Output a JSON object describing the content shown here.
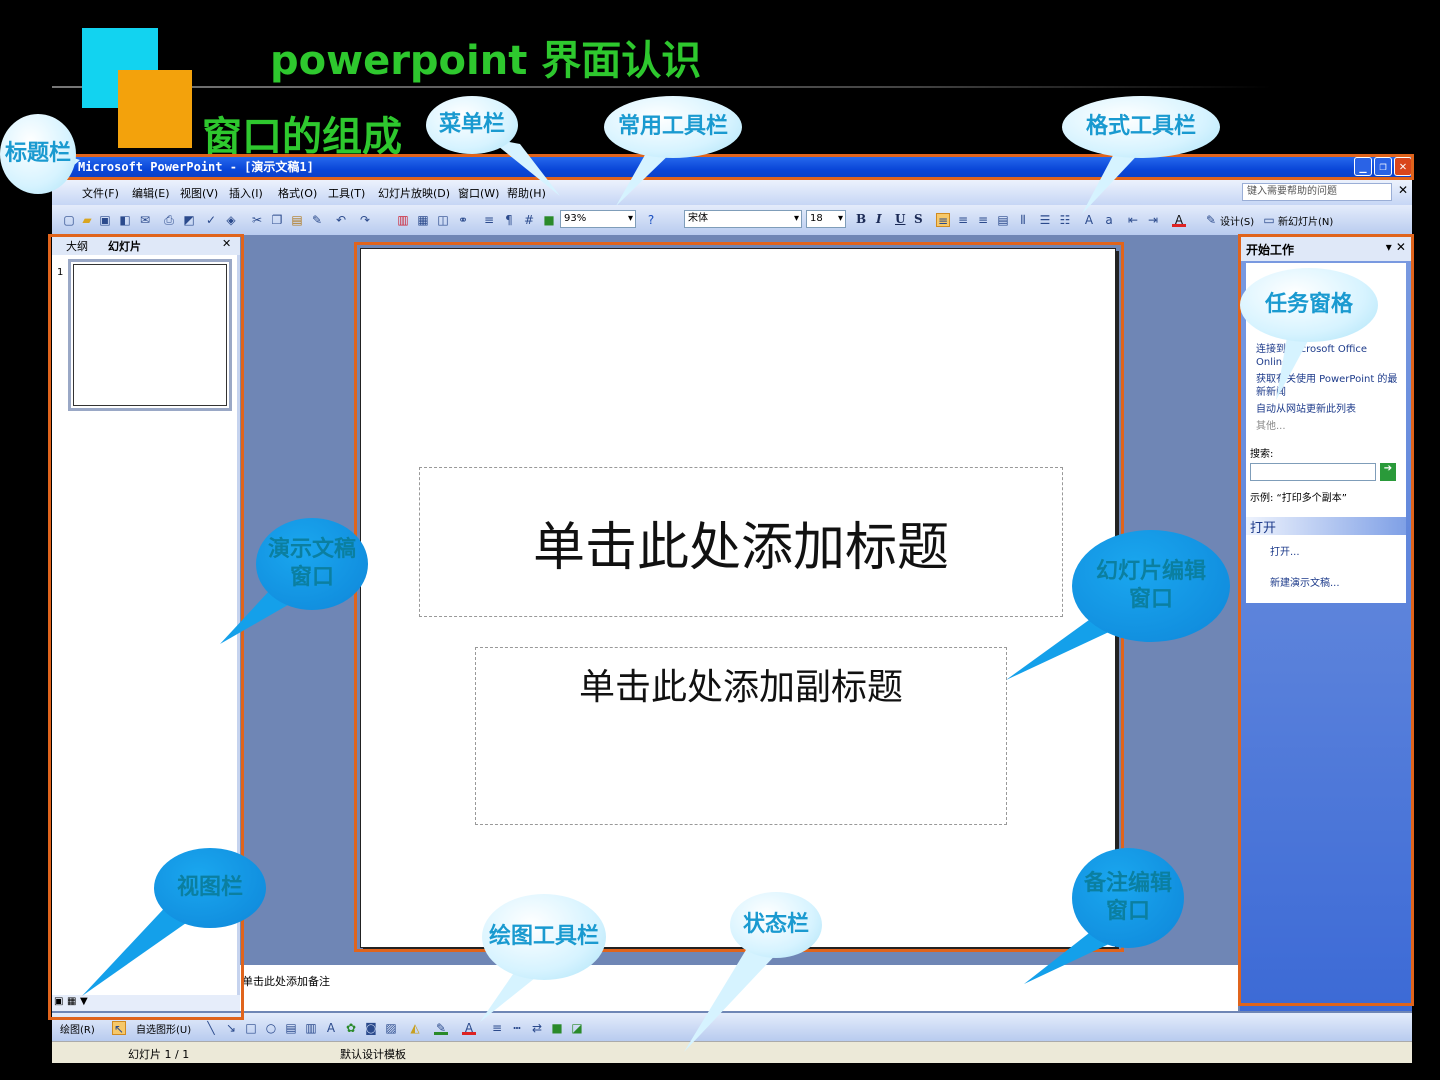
{
  "slide": {
    "title": "powerpoint 界面认识",
    "subtitle": "窗口的组成"
  },
  "window": {
    "title": "Microsoft PowerPoint - [演示文稿1]",
    "menu": [
      "文件(F)",
      "编辑(E)",
      "视图(V)",
      "插入(I)",
      "格式(O)",
      "工具(T)",
      "幻灯片放映(D)",
      "窗口(W)",
      "帮助(H)"
    ],
    "help_placeholder": "键入需要帮助的问题",
    "zoom": "93%",
    "font": "宋体",
    "font_size": "18",
    "format_buttons": [
      "B",
      "I",
      "U",
      "S"
    ],
    "design_label": "设计(S)",
    "new_slide_label": "新幻灯片(N)"
  },
  "left_pane": {
    "tabs": [
      "大纲",
      "幻灯片"
    ],
    "slide_number": "1"
  },
  "editor": {
    "title_placeholder": "单击此处添加标题",
    "subtitle_placeholder": "单击此处添加副标题",
    "notes_placeholder": "单击此处添加备注"
  },
  "task_pane": {
    "header": "开始工作",
    "links": [
      "连接到 Microsoft Office Online",
      "获取有关使用 PowerPoint 的最新新闻",
      "自动从网站更新此列表"
    ],
    "more": "其他...",
    "search_label": "搜索:",
    "example": "示例: “打印多个副本”",
    "open_section": "打开",
    "open_link": "打开...",
    "new_link": "新建演示文稿..."
  },
  "draw_bar": {
    "draw_label": "绘图(R)",
    "autoshapes_label": "自选图形(U)"
  },
  "status_bar": {
    "slide_info": "幻灯片 1 / 1",
    "template": "默认设计模板"
  },
  "callouts": {
    "title_bar": "标题栏",
    "menu_bar": "菜单栏",
    "standard_toolbar": "常用工具栏",
    "format_toolbar": "格式工具栏",
    "task_pane": "任务窗格",
    "outline_pane": "演示文稿窗口",
    "slide_edit": "幻灯片编辑窗口",
    "view_bar": "视图栏",
    "draw_toolbar": "绘图工具栏",
    "status_bar": "状态栏",
    "notes_pane": "备注编辑窗口"
  },
  "colors": {
    "heading_green": "#2ec82e",
    "highlight_orange": "#e0641c",
    "title_bar_blue": "#0a46d8",
    "callout_cyan": "#1a9ad0"
  }
}
